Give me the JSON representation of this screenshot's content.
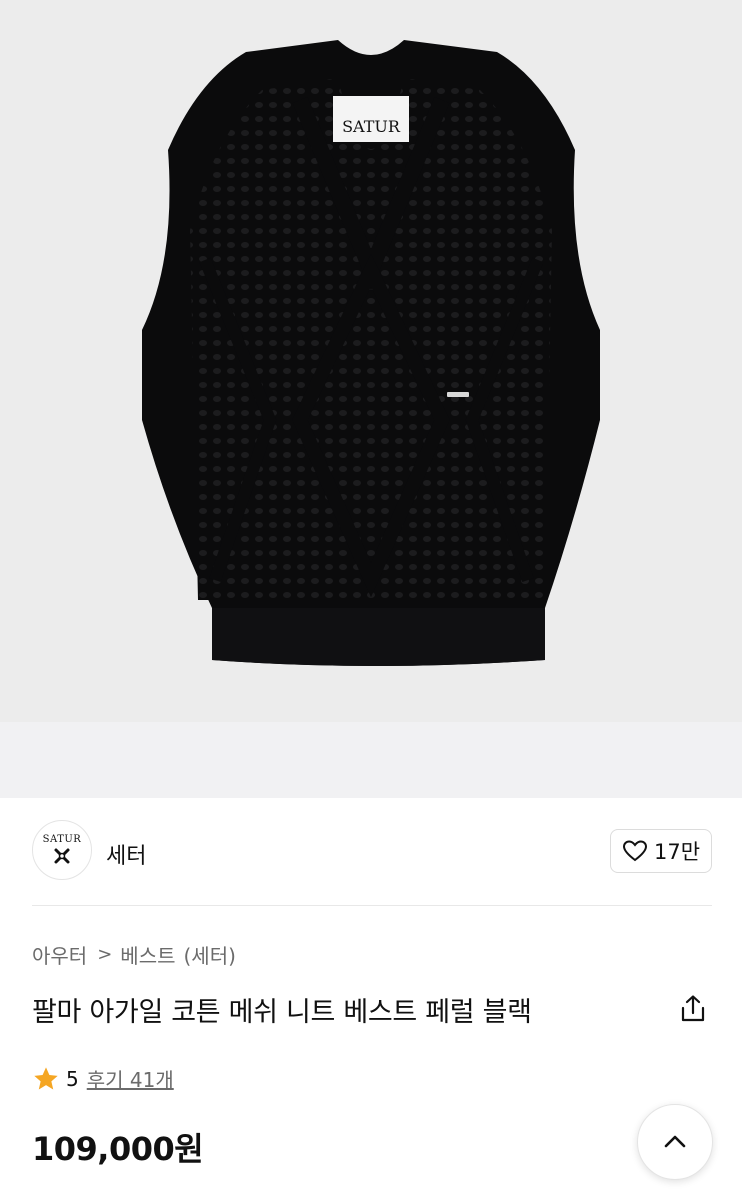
{
  "product_image": {
    "label_text": "SATUR",
    "garment_color": "#0b0b0c",
    "background_color": "#ececec"
  },
  "brand": {
    "logo_text": "SATUR",
    "name": "세터",
    "like_count": "17만"
  },
  "breadcrumb": {
    "category": "아우터",
    "separator": ">",
    "subcategory": "베스트",
    "brand": "(세터)"
  },
  "product": {
    "title": "팔마 아가일 코튼 메쉬 니트 베스트 페럴 블랙",
    "rating": "5",
    "reviews": "후기 41개",
    "price": "109,000원"
  },
  "colors": {
    "star": "#f5a623",
    "muted_text": "#6b6b6b"
  },
  "icons": {
    "like": "heart-outline-icon",
    "share": "share-icon",
    "rating": "star-icon",
    "scroll_top": "chevron-up-icon"
  }
}
